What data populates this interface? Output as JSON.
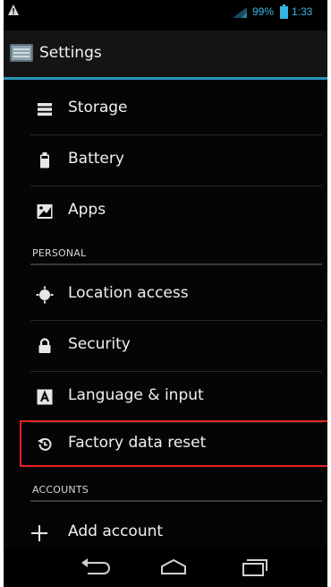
{
  "status_bar": {
    "battery_percent": "99%",
    "time": "1:33",
    "accent_color": "#33b5e5"
  },
  "action_bar": {
    "title": "Settings",
    "icon": "settings-app-icon"
  },
  "items": [
    {
      "label": "Storage",
      "icon": "storage-icon"
    },
    {
      "label": "Battery",
      "icon": "battery-icon"
    },
    {
      "label": "Apps",
      "icon": "apps-icon"
    },
    {
      "label": "Location access",
      "icon": "location-icon"
    },
    {
      "label": "Security",
      "icon": "lock-icon"
    },
    {
      "label": "Language & input",
      "icon": "language-icon"
    },
    {
      "label": "Factory data reset",
      "icon": "restore-icon"
    },
    {
      "label": "Add account",
      "icon": "plus-icon"
    }
  ],
  "sections": {
    "personal": "PERSONAL",
    "accounts": "ACCOUNTS"
  },
  "highlight_color": "#e42226",
  "nav_bar": {
    "buttons": [
      "back-icon",
      "home-icon",
      "recent-apps-icon"
    ]
  }
}
